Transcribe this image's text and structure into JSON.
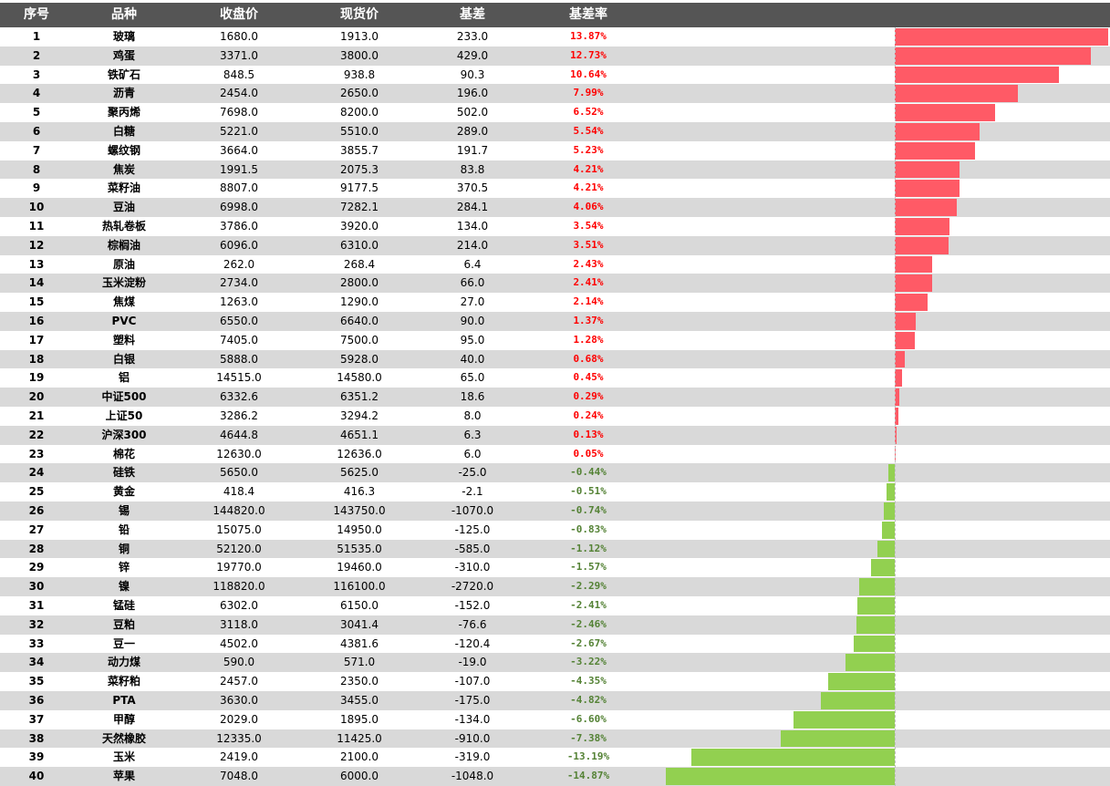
{
  "headers": [
    "序号",
    "品种",
    "收盘价",
    "现货价",
    "基差",
    "基差率"
  ],
  "colors": {
    "header_bg": "#555555",
    "header_text": "#ffffff",
    "alt_row": "#d9d9d9",
    "positive": "#ff0000",
    "negative": "#548235",
    "bar_positive": "#ff5a66",
    "bar_negative": "#92d050"
  },
  "chart_data": {
    "type": "bar",
    "orientation": "horizontal",
    "columns": [
      "序号",
      "品种",
      "收盘价",
      "现货价",
      "基差",
      "基差率"
    ],
    "rows": [
      {
        "no": "1",
        "name": "玻璃",
        "close": "1680.0",
        "spot": "1913.0",
        "basis": "233.0",
        "rate_text": "13.87%",
        "rate": 13.87
      },
      {
        "no": "2",
        "name": "鸡蛋",
        "close": "3371.0",
        "spot": "3800.0",
        "basis": "429.0",
        "rate_text": "12.73%",
        "rate": 12.73
      },
      {
        "no": "3",
        "name": "铁矿石",
        "close": "848.5",
        "spot": "938.8",
        "basis": "90.3",
        "rate_text": "10.64%",
        "rate": 10.64
      },
      {
        "no": "4",
        "name": "沥青",
        "close": "2454.0",
        "spot": "2650.0",
        "basis": "196.0",
        "rate_text": "7.99%",
        "rate": 7.99
      },
      {
        "no": "5",
        "name": "聚丙烯",
        "close": "7698.0",
        "spot": "8200.0",
        "basis": "502.0",
        "rate_text": "6.52%",
        "rate": 6.52
      },
      {
        "no": "6",
        "name": "白糖",
        "close": "5221.0",
        "spot": "5510.0",
        "basis": "289.0",
        "rate_text": "5.54%",
        "rate": 5.54
      },
      {
        "no": "7",
        "name": "螺纹钢",
        "close": "3664.0",
        "spot": "3855.7",
        "basis": "191.7",
        "rate_text": "5.23%",
        "rate": 5.23
      },
      {
        "no": "8",
        "name": "焦炭",
        "close": "1991.5",
        "spot": "2075.3",
        "basis": "83.8",
        "rate_text": "4.21%",
        "rate": 4.21
      },
      {
        "no": "9",
        "name": "菜籽油",
        "close": "8807.0",
        "spot": "9177.5",
        "basis": "370.5",
        "rate_text": "4.21%",
        "rate": 4.21
      },
      {
        "no": "10",
        "name": "豆油",
        "close": "6998.0",
        "spot": "7282.1",
        "basis": "284.1",
        "rate_text": "4.06%",
        "rate": 4.06
      },
      {
        "no": "11",
        "name": "热轧卷板",
        "close": "3786.0",
        "spot": "3920.0",
        "basis": "134.0",
        "rate_text": "3.54%",
        "rate": 3.54
      },
      {
        "no": "12",
        "name": "棕榈油",
        "close": "6096.0",
        "spot": "6310.0",
        "basis": "214.0",
        "rate_text": "3.51%",
        "rate": 3.51
      },
      {
        "no": "13",
        "name": "原油",
        "close": "262.0",
        "spot": "268.4",
        "basis": "6.4",
        "rate_text": "2.43%",
        "rate": 2.43
      },
      {
        "no": "14",
        "name": "玉米淀粉",
        "close": "2734.0",
        "spot": "2800.0",
        "basis": "66.0",
        "rate_text": "2.41%",
        "rate": 2.41
      },
      {
        "no": "15",
        "name": "焦煤",
        "close": "1263.0",
        "spot": "1290.0",
        "basis": "27.0",
        "rate_text": "2.14%",
        "rate": 2.14
      },
      {
        "no": "16",
        "name": "PVC",
        "close": "6550.0",
        "spot": "6640.0",
        "basis": "90.0",
        "rate_text": "1.37%",
        "rate": 1.37
      },
      {
        "no": "17",
        "name": "塑料",
        "close": "7405.0",
        "spot": "7500.0",
        "basis": "95.0",
        "rate_text": "1.28%",
        "rate": 1.28
      },
      {
        "no": "18",
        "name": "白银",
        "close": "5888.0",
        "spot": "5928.0",
        "basis": "40.0",
        "rate_text": "0.68%",
        "rate": 0.68
      },
      {
        "no": "19",
        "name": "铝",
        "close": "14515.0",
        "spot": "14580.0",
        "basis": "65.0",
        "rate_text": "0.45%",
        "rate": 0.45
      },
      {
        "no": "20",
        "name": "中证500",
        "close": "6332.6",
        "spot": "6351.2",
        "basis": "18.6",
        "rate_text": "0.29%",
        "rate": 0.29
      },
      {
        "no": "21",
        "name": "上证50",
        "close": "3286.2",
        "spot": "3294.2",
        "basis": "8.0",
        "rate_text": "0.24%",
        "rate": 0.24
      },
      {
        "no": "22",
        "name": "沪深300",
        "close": "4644.8",
        "spot": "4651.1",
        "basis": "6.3",
        "rate_text": "0.13%",
        "rate": 0.13
      },
      {
        "no": "23",
        "name": "棉花",
        "close": "12630.0",
        "spot": "12636.0",
        "basis": "6.0",
        "rate_text": "0.05%",
        "rate": 0.05
      },
      {
        "no": "24",
        "name": "硅铁",
        "close": "5650.0",
        "spot": "5625.0",
        "basis": "-25.0",
        "rate_text": "-0.44%",
        "rate": -0.44
      },
      {
        "no": "25",
        "name": "黄金",
        "close": "418.4",
        "spot": "416.3",
        "basis": "-2.1",
        "rate_text": "-0.51%",
        "rate": -0.51
      },
      {
        "no": "26",
        "name": "锡",
        "close": "144820.0",
        "spot": "143750.0",
        "basis": "-1070.0",
        "rate_text": "-0.74%",
        "rate": -0.74
      },
      {
        "no": "27",
        "name": "铅",
        "close": "15075.0",
        "spot": "14950.0",
        "basis": "-125.0",
        "rate_text": "-0.83%",
        "rate": -0.83
      },
      {
        "no": "28",
        "name": "铜",
        "close": "52120.0",
        "spot": "51535.0",
        "basis": "-585.0",
        "rate_text": "-1.12%",
        "rate": -1.12
      },
      {
        "no": "29",
        "name": "锌",
        "close": "19770.0",
        "spot": "19460.0",
        "basis": "-310.0",
        "rate_text": "-1.57%",
        "rate": -1.57
      },
      {
        "no": "30",
        "name": "镍",
        "close": "118820.0",
        "spot": "116100.0",
        "basis": "-2720.0",
        "rate_text": "-2.29%",
        "rate": -2.29
      },
      {
        "no": "31",
        "name": "锰硅",
        "close": "6302.0",
        "spot": "6150.0",
        "basis": "-152.0",
        "rate_text": "-2.41%",
        "rate": -2.41
      },
      {
        "no": "32",
        "name": "豆粕",
        "close": "3118.0",
        "spot": "3041.4",
        "basis": "-76.6",
        "rate_text": "-2.46%",
        "rate": -2.46
      },
      {
        "no": "33",
        "name": "豆一",
        "close": "4502.0",
        "spot": "4381.6",
        "basis": "-120.4",
        "rate_text": "-2.67%",
        "rate": -2.67
      },
      {
        "no": "34",
        "name": "动力煤",
        "close": "590.0",
        "spot": "571.0",
        "basis": "-19.0",
        "rate_text": "-3.22%",
        "rate": -3.22
      },
      {
        "no": "35",
        "name": "菜籽粕",
        "close": "2457.0",
        "spot": "2350.0",
        "basis": "-107.0",
        "rate_text": "-4.35%",
        "rate": -4.35
      },
      {
        "no": "36",
        "name": "PTA",
        "close": "3630.0",
        "spot": "3455.0",
        "basis": "-175.0",
        "rate_text": "-4.82%",
        "rate": -4.82
      },
      {
        "no": "37",
        "name": "甲醇",
        "close": "2029.0",
        "spot": "1895.0",
        "basis": "-134.0",
        "rate_text": "-6.60%",
        "rate": -6.6
      },
      {
        "no": "38",
        "name": "天然橡胶",
        "close": "12335.0",
        "spot": "11425.0",
        "basis": "-910.0",
        "rate_text": "-7.38%",
        "rate": -7.38
      },
      {
        "no": "39",
        "name": "玉米",
        "close": "2419.0",
        "spot": "2100.0",
        "basis": "-319.0",
        "rate_text": "-13.19%",
        "rate": -13.19
      },
      {
        "no": "40",
        "name": "苹果",
        "close": "7048.0",
        "spot": "6000.0",
        "basis": "-1048.0",
        "rate_text": "-14.87%",
        "rate": -14.87
      }
    ],
    "xlim": [
      -14.87,
      13.87
    ]
  }
}
